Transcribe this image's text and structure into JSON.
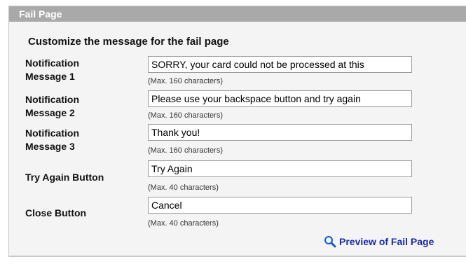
{
  "page": {
    "header_title": "Fail Page",
    "section_title": "Customize the message for the fail page",
    "fields": [
      {
        "label_line1": "Notification",
        "label_line2": "Message 1",
        "value": "SORRY, your card could not be processed at this",
        "hint": "(Max. 160 characters)"
      },
      {
        "label_line1": "Notification",
        "label_line2": "Message 2",
        "value": "Please use your backspace button and try again",
        "hint": "(Max. 160 characters)"
      },
      {
        "label_line1": "Notification",
        "label_line2": "Message 3",
        "value": "Thank you!",
        "hint": "(Max. 160 characters)"
      },
      {
        "label_line1": "Try Again Button",
        "label_line2": "",
        "value": "Try Again",
        "hint": "(Max. 40 characters)"
      },
      {
        "label_line1": "Close Button",
        "label_line2": "",
        "value": "Cancel",
        "hint": "(Max. 40 characters)"
      }
    ],
    "preview_link": "Preview of Fail Page",
    "preview_icon": "magnifier-icon",
    "colors": {
      "header_bg": "#a9a9a9",
      "link": "#1b2aa8",
      "panel_bg": "#f4f4f4"
    }
  }
}
